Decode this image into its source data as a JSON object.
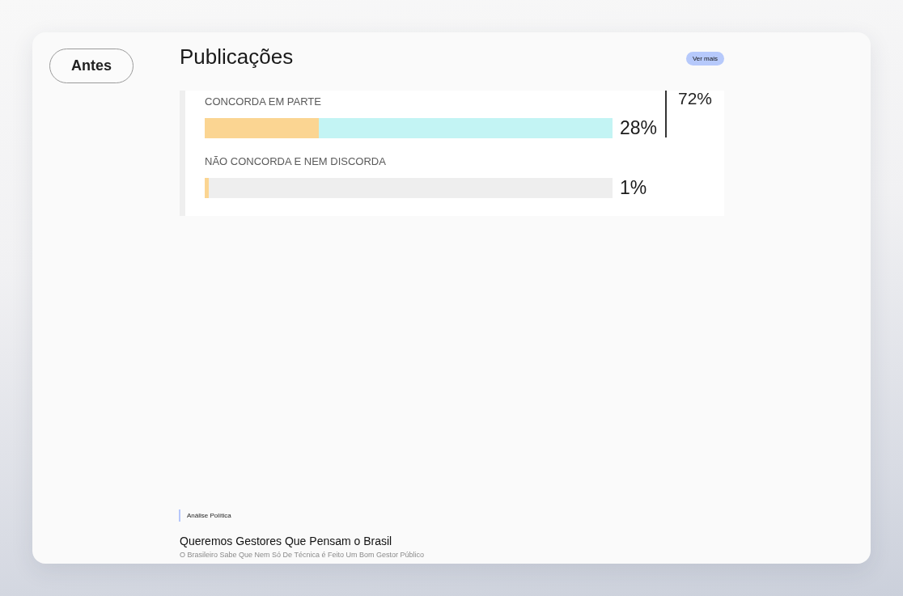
{
  "back_button": {
    "label": "Antes"
  },
  "section": {
    "title": "Publicações",
    "more_button": "Ver mais"
  },
  "featured_image": {
    "side_reading": "72%",
    "rows": [
      {
        "label": "CONCORDA EM PARTE",
        "level": 0.28,
        "reading": "28%",
        "color": "#c3f4f4"
      },
      {
        "label": "NÃO CONCORDA E NEM DISCORDA",
        "level": 0.01,
        "reading": "1%",
        "color": "#eeeeee"
      }
    ]
  },
  "post": {
    "category": "Análise Política",
    "title": "Queremos Gestores Que Pensam o Brasil",
    "subtitle": "O Brasileiro Sabe Que Nem Só De Técnica é Feito Um Bom Gestor Público"
  }
}
